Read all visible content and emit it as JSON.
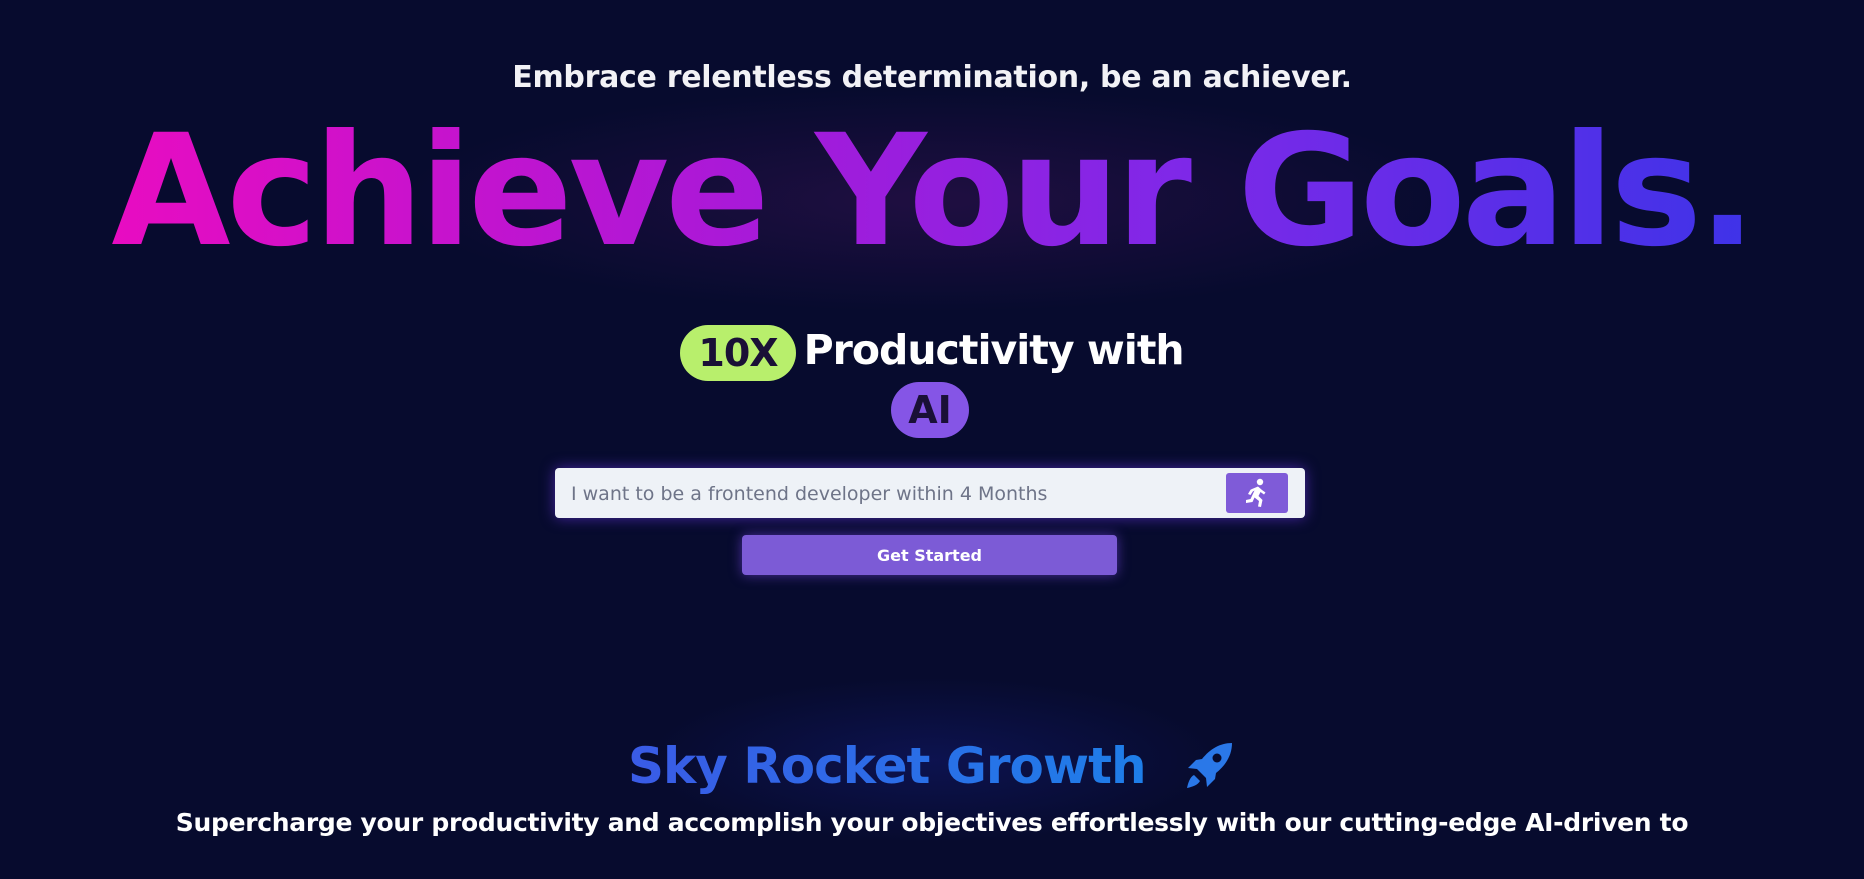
{
  "hero": {
    "tagline": "Embrace relentless determination, be an achiever.",
    "title": "Achieve Your Goals.",
    "productivity": {
      "badge_10x": "10X",
      "text": "Productivity with",
      "badge_ai": "AI"
    }
  },
  "goal_form": {
    "placeholder": "I want to be a frontend developer within 4 Months",
    "value": "",
    "submit_icon": "running-person-icon",
    "cta_label": "Get Started"
  },
  "growth_section": {
    "title": "Sky Rocket Growth",
    "icon": "rocket-icon",
    "description": "Supercharge your productivity and accomplish your objectives effortlessly with our cutting-edge AI-driven to"
  },
  "colors": {
    "background": "#070b2e",
    "title_gradient_start": "#e80cc1",
    "title_gradient_end": "#3e33e8",
    "badge_10x": "#b8ef6c",
    "badge_ai": "#8555e6",
    "button": "#7c5bd6",
    "section_title": "#1e7ee8"
  }
}
